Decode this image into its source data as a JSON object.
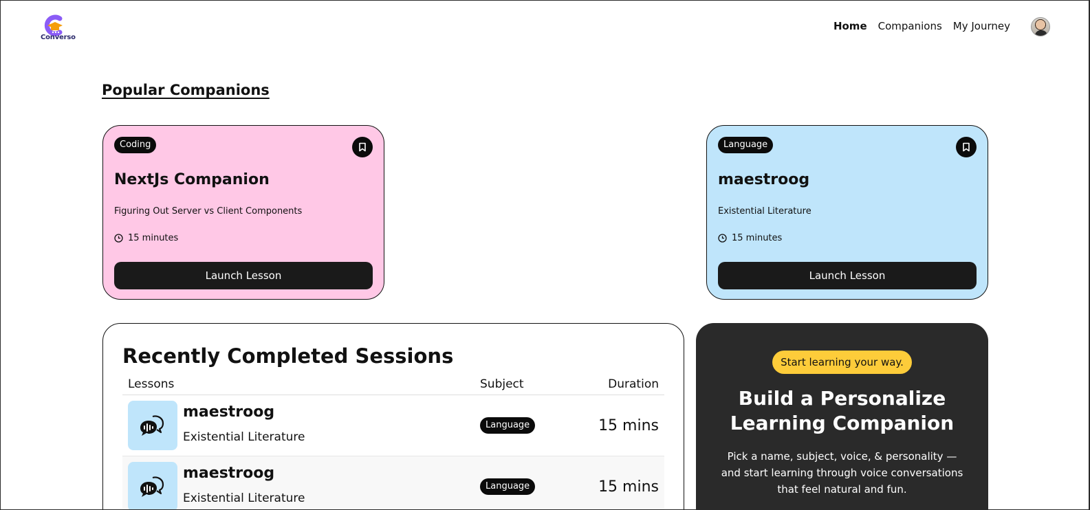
{
  "brand": {
    "name": "Converso",
    "colors": {
      "primary": "#8b5cf6",
      "accent": "#f59e0b"
    }
  },
  "nav": {
    "items": [
      {
        "label": "Home",
        "active": true
      },
      {
        "label": "Companions",
        "active": false
      },
      {
        "label": "My Journey",
        "active": false
      }
    ]
  },
  "popular": {
    "title": "Popular Companions",
    "cards": [
      {
        "subject": "Coding",
        "name": "NextJs Companion",
        "topic": "Figuring Out Server vs Client Components",
        "duration": "15 minutes",
        "cta": "Launch Lesson",
        "color": "#ffc8e6",
        "icon": "bookmark-icon"
      },
      {
        "subject": "Language",
        "name": "maestroog",
        "topic": "Existential Literature",
        "duration": "15 minutes",
        "cta": "Launch Lesson",
        "color": "#bfe5fb",
        "icon": "bookmark-icon"
      }
    ]
  },
  "sessions": {
    "title": "Recently Completed Sessions",
    "columns": [
      "Lessons",
      "Subject",
      "Duration"
    ],
    "rows": [
      {
        "name": "maestroog",
        "topic": "Existential Literature",
        "subject": "Language",
        "duration": "15 mins"
      },
      {
        "name": "maestroog",
        "topic": "Existential Literature",
        "subject": "Language",
        "duration": "15 mins"
      }
    ]
  },
  "cta": {
    "badge": "Start learning your way.",
    "title": "Build a Personalize Learning Companion",
    "description": "Pick a name, subject, voice, & personality — and start learning through voice conversations that feel natural and fun."
  }
}
